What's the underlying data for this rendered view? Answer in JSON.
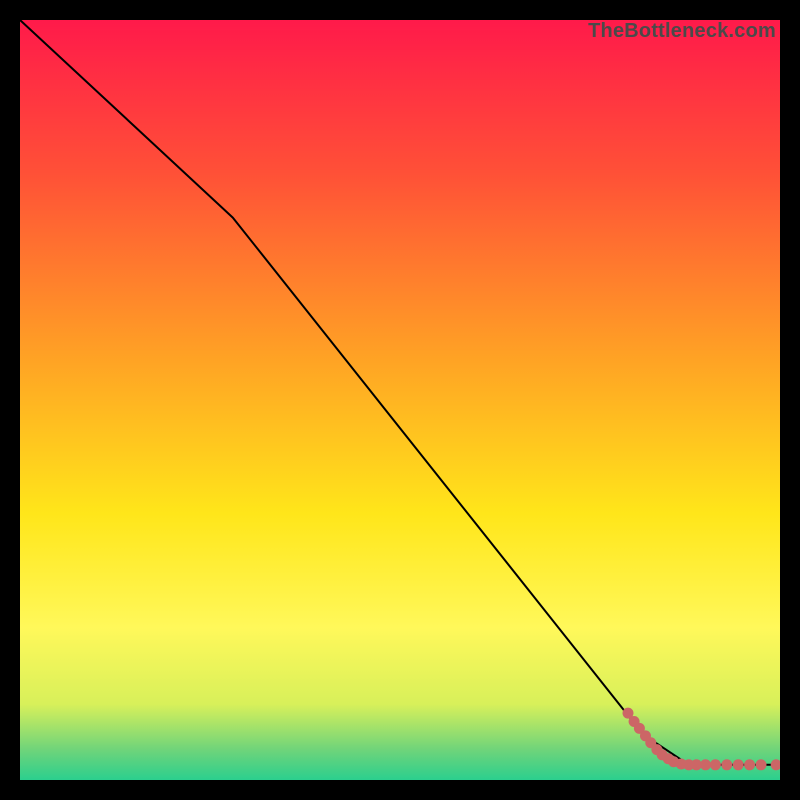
{
  "watermark": "TheBottleneck.com",
  "chart_data": {
    "type": "line",
    "title": "",
    "xlabel": "",
    "ylabel": "",
    "xlim": [
      0,
      100
    ],
    "ylim": [
      0,
      100
    ],
    "grid": false,
    "series": [
      {
        "name": "curve",
        "color": "#000000",
        "x": [
          0,
          28,
          82,
          88,
          100
        ],
        "y": [
          100,
          74,
          6,
          2,
          2
        ]
      },
      {
        "name": "markers",
        "color": "#cc6666",
        "points": [
          {
            "x": 80.0,
            "y": 8.8
          },
          {
            "x": 80.8,
            "y": 7.7
          },
          {
            "x": 81.5,
            "y": 6.8
          },
          {
            "x": 82.3,
            "y": 5.8
          },
          {
            "x": 83.0,
            "y": 4.9
          },
          {
            "x": 83.8,
            "y": 4.0
          },
          {
            "x": 84.5,
            "y": 3.3
          },
          {
            "x": 85.3,
            "y": 2.8
          },
          {
            "x": 86.0,
            "y": 2.4
          },
          {
            "x": 87.0,
            "y": 2.1
          },
          {
            "x": 88.0,
            "y": 2.0
          },
          {
            "x": 89.0,
            "y": 2.0
          },
          {
            "x": 90.2,
            "y": 2.0
          },
          {
            "x": 91.5,
            "y": 2.0
          },
          {
            "x": 93.0,
            "y": 2.0
          },
          {
            "x": 94.5,
            "y": 2.0
          },
          {
            "x": 96.0,
            "y": 2.0
          },
          {
            "x": 97.5,
            "y": 2.0
          },
          {
            "x": 99.5,
            "y": 2.0
          }
        ]
      }
    ],
    "background_gradient": {
      "stops": [
        {
          "offset": 0.0,
          "color": "#ff1a4a"
        },
        {
          "offset": 0.2,
          "color": "#ff5037"
        },
        {
          "offset": 0.45,
          "color": "#ffa424"
        },
        {
          "offset": 0.65,
          "color": "#ffe61a"
        },
        {
          "offset": 0.8,
          "color": "#fff85a"
        },
        {
          "offset": 0.9,
          "color": "#d8f05a"
        },
        {
          "offset": 0.96,
          "color": "#6fd47a"
        },
        {
          "offset": 1.0,
          "color": "#2bcf8e"
        }
      ]
    }
  }
}
